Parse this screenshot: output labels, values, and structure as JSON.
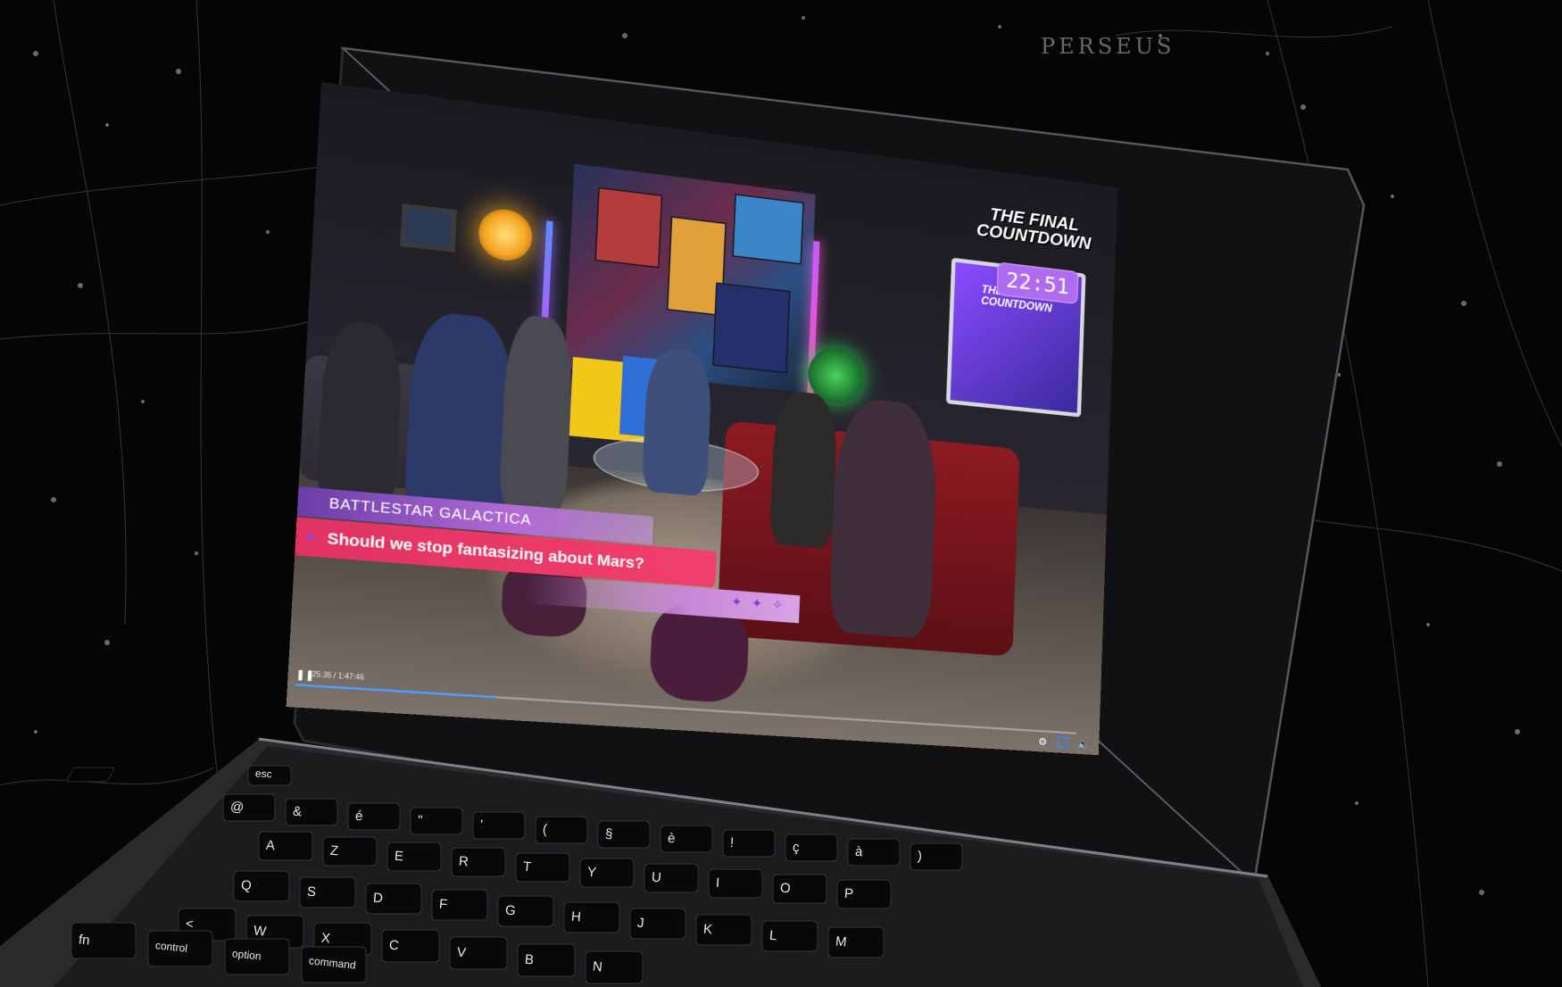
{
  "background": {
    "constellation_labels": [
      "PERSEUS"
    ]
  },
  "video": {
    "show_logo": "THE FINAL COUNTDOWN",
    "screen_panel_text": "THE FINAL COUNTDOWN",
    "clock": "22:51",
    "lower_third": {
      "subtitle": "BATTLESTAR GALACTICA",
      "headline": "Should we stop fantasizing about Mars?"
    },
    "player": {
      "play_icon": "pause-icon",
      "time": "25:35 / 1:47:46",
      "progress_fraction": 0.24,
      "settings_icon": "gear-icon",
      "pip_icon": "picture-in-picture-icon",
      "volume_icon": "volume-icon"
    }
  },
  "keyboard": {
    "rows": [
      [
        "esc"
      ],
      [
        "@",
        "&",
        "é",
        "\"",
        "'",
        "(",
        "§",
        "è",
        "!",
        "ç",
        "à",
        ")"
      ],
      [
        "A",
        "Z",
        "E",
        "R",
        "T",
        "Y",
        "U",
        "I",
        "O",
        "P"
      ],
      [
        "Q",
        "S",
        "D",
        "F",
        "G",
        "H",
        "J",
        "K",
        "L",
        "M"
      ],
      [
        "<",
        "W",
        "X",
        "C",
        "V",
        "B",
        "N"
      ],
      [
        "fn",
        "control",
        "option",
        "command"
      ]
    ]
  },
  "colors": {
    "accent_purple": "#b06cf0",
    "headline_red": "#e03363",
    "progress_blue": "#4aa0ff"
  }
}
